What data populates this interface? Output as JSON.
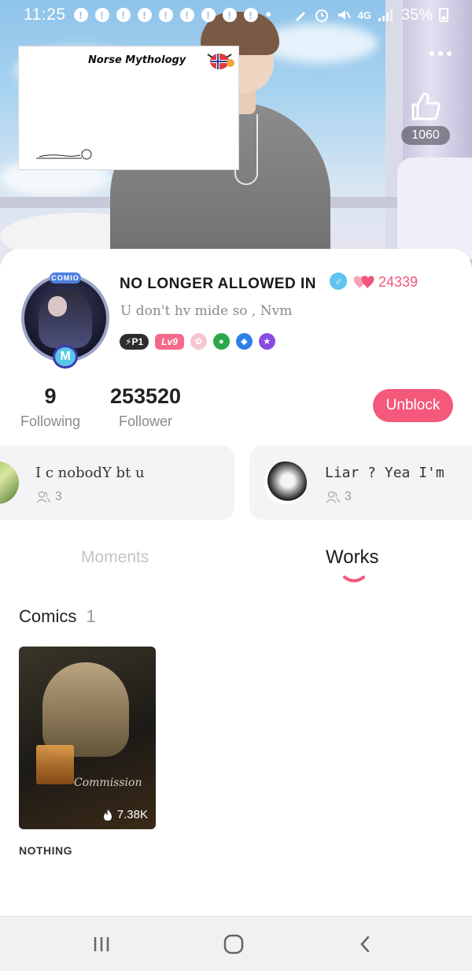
{
  "status_bar": {
    "time": "11:25",
    "notification_count": 9,
    "network": "4G",
    "battery": "35%"
  },
  "sticker": {
    "title": "Norse Mythology"
  },
  "header": {
    "like_count": "1060"
  },
  "profile": {
    "username": "NO LONGER ALLOWED IN",
    "gender_symbol": "♂",
    "heart_count": "24339",
    "bio": "U don't hv mide so , Nvm",
    "badges": {
      "p1": "P1",
      "level": "Lv9"
    }
  },
  "avatar": {
    "top_label": "COMIO",
    "bottom_label": "M"
  },
  "stats": {
    "following_count": "9",
    "following_label": "Following",
    "follower_count": "253520",
    "follower_label": "Follower",
    "unblock_label": "Unblock"
  },
  "groups": [
    {
      "name": "I ϲ nobodY bt u",
      "members": "3"
    },
    {
      "name": "Liar ? Yea I'm",
      "members": "3"
    }
  ],
  "tabs": {
    "moments": "Moments",
    "works": "Works",
    "active": "works"
  },
  "comics": {
    "section_title": "Comics",
    "count": "1",
    "items": [
      {
        "title": "NOTHING",
        "views": "7.38K",
        "cover_text": "Commission"
      }
    ]
  },
  "colors": {
    "accent": "#f4587a",
    "active_tab_underline": "#f4587a",
    "inactive_tab": "#c4c4c4"
  }
}
